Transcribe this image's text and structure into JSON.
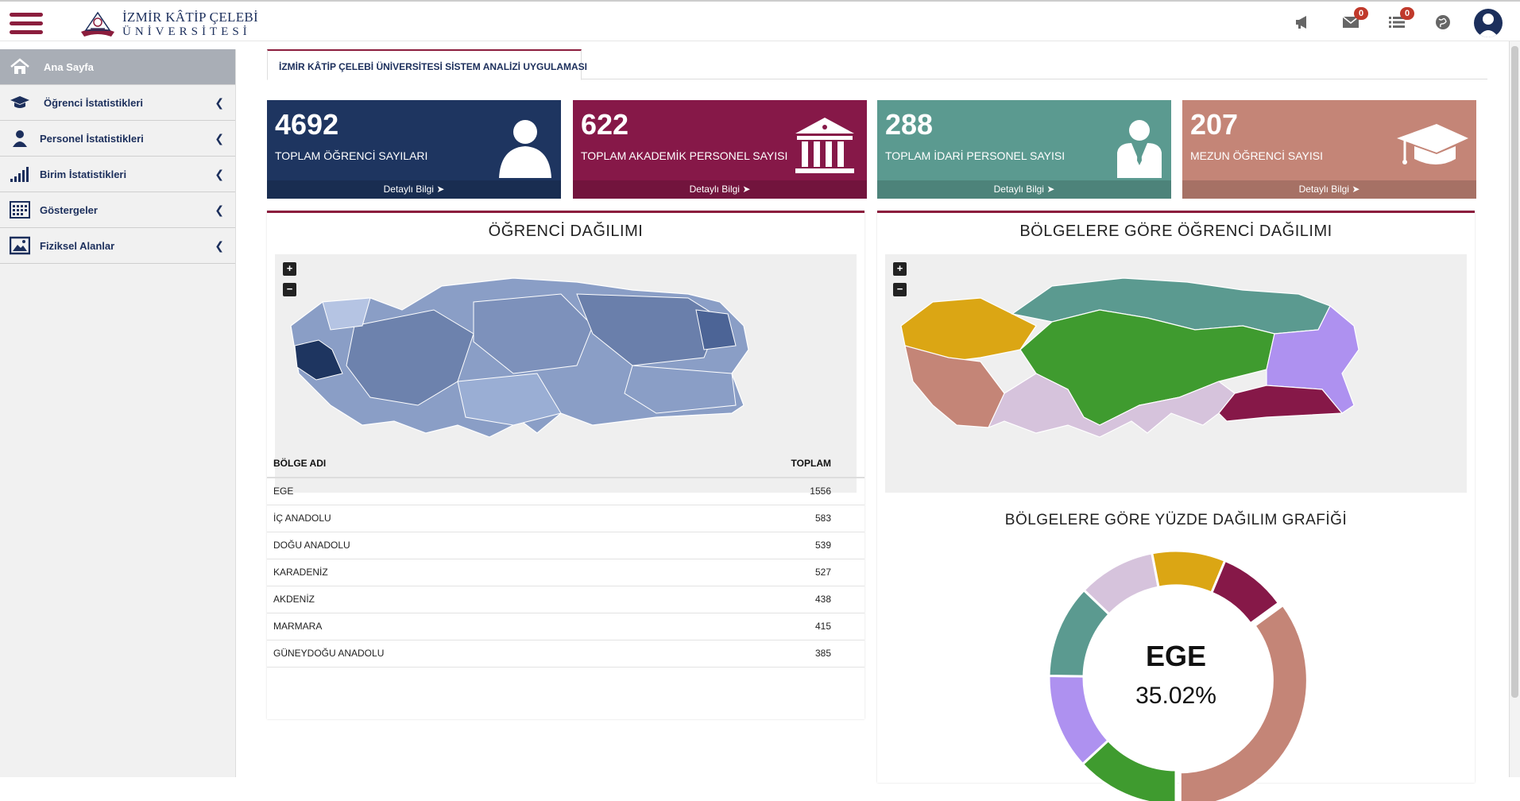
{
  "header": {
    "logo_line1": "İZMİR KÂTİP ÇELEBİ",
    "logo_line2": "ÜNİVERSİTESİ",
    "messages_badge": "0",
    "tasks_badge": "0"
  },
  "sidebar": {
    "items": [
      {
        "label": "Ana Sayfa",
        "icon": "home-icon"
      },
      {
        "label": "Öğrenci İstatistikleri",
        "icon": "graduation-cap-icon"
      },
      {
        "label": "Personel İstatistikleri",
        "icon": "user-icon"
      },
      {
        "label": "Birim İstatistikleri",
        "icon": "signal-bars-icon"
      },
      {
        "label": "Göstergeler",
        "icon": "calendar-grid-icon"
      },
      {
        "label": "Fiziksel Alanlar",
        "icon": "picture-icon"
      }
    ]
  },
  "tab": {
    "label": "İZMİR KÂTİP ÇELEBİ ÜNİVERSİTESİ SİSTEM ANALİZİ UYGULAMASI"
  },
  "cards": [
    {
      "value": "4692",
      "label": "TOPLAM ÖĞRENCİ SAYILARI",
      "footer": "Detaylı Bilgi",
      "color": "#1e3560",
      "icon": "user-silhouette-icon"
    },
    {
      "value": "622",
      "label": "TOPLAM AKADEMİK PERSONEL SAYISI",
      "footer": "Detaylı Bilgi",
      "color": "#861848",
      "icon": "university-building-icon"
    },
    {
      "value": "288",
      "label": "TOPLAM İDARİ PERSONEL SAYISI",
      "footer": "Detaylı Bilgi",
      "color": "#5b9a90",
      "icon": "user-tie-icon"
    },
    {
      "value": "207",
      "label": "MEZUN ÖĞRENCİ SAYISI",
      "footer": "Detaylı Bilgi",
      "color": "#c48577",
      "icon": "mortarboard-icon"
    }
  ],
  "student_map": {
    "title": "ÖĞRENCİ DAĞILIMI",
    "zoom_in": "+",
    "zoom_out": "−"
  },
  "region_table": {
    "headers": [
      "BÖLGE ADI",
      "TOPLAM"
    ],
    "rows": [
      [
        "EGE",
        "1556"
      ],
      [
        "İÇ ANADOLU",
        "583"
      ],
      [
        "DOĞU ANADOLU",
        "539"
      ],
      [
        "KARADENİZ",
        "527"
      ],
      [
        "AKDENİZ",
        "438"
      ],
      [
        "MARMARA",
        "415"
      ],
      [
        "GÜNEYDOĞU ANADOLU",
        "385"
      ]
    ]
  },
  "region_map": {
    "title": "BÖLGELERE GÖRE ÖĞRENCİ DAĞILIMI",
    "zoom_in": "+",
    "zoom_out": "−",
    "colors": {
      "MARMARA": "#dba614",
      "EGE": "#c48577",
      "AKDENİZ": "#d6c3dc",
      "İÇ ANADOLU": "#3f9b2f",
      "KARADENİZ": "#5b9a90",
      "DOĞU ANADOLU": "#ae91f0",
      "GÜNEYDOĞU ANADOLU": "#861848"
    }
  },
  "chart_data": {
    "type": "pie",
    "title": "BÖLGELERE GÖRE YÜZDE DAĞILIM GRAFİĞİ",
    "center_label": "EGE",
    "center_value": "35.02%",
    "categories": [
      "EGE",
      "İÇ ANADOLU",
      "DOĞU ANADOLU",
      "KARADENİZ",
      "AKDENİZ",
      "MARMARA",
      "GÜNEYDOĞU ANADOLU"
    ],
    "values": [
      1556,
      583,
      539,
      527,
      438,
      415,
      385
    ],
    "colors": [
      "#c48577",
      "#3f9b2f",
      "#ae91f0",
      "#5b9a90",
      "#d6c3dc",
      "#dba614",
      "#861848"
    ]
  }
}
